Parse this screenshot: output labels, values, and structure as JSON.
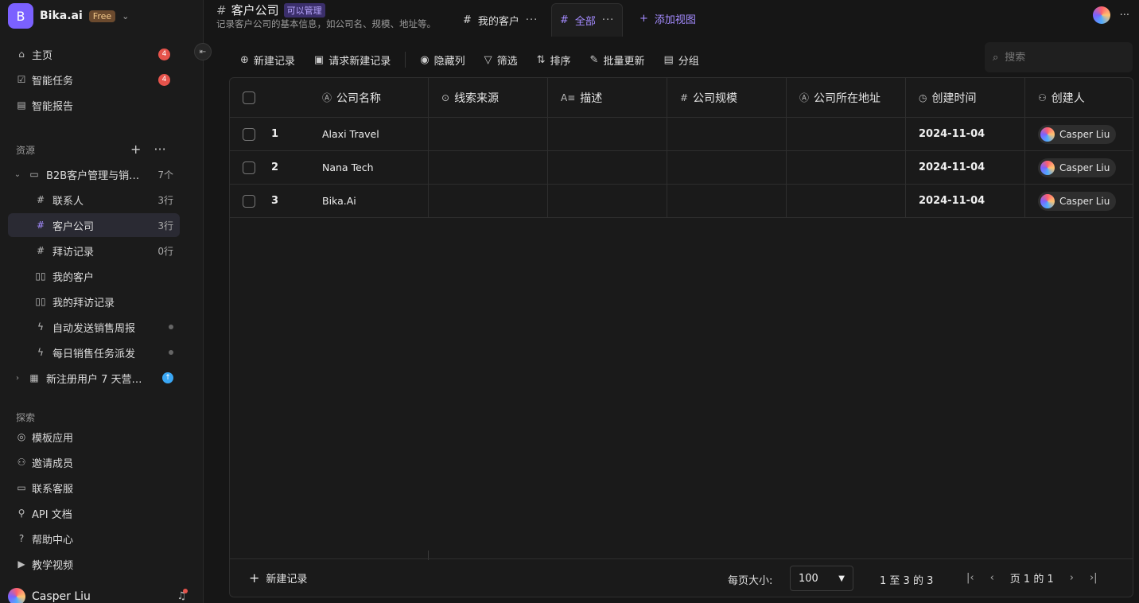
{
  "workspace": {
    "initial": "B",
    "name": "Bika.ai",
    "plan": "Free"
  },
  "nav": [
    {
      "label": "主页",
      "badge": "4"
    },
    {
      "label": "智能任务",
      "badge": "4"
    },
    {
      "label": "智能报告"
    }
  ],
  "resources": {
    "title": "资源",
    "folder": {
      "label": "B2B客户管理与销…",
      "count": "7个"
    },
    "items": [
      {
        "label": "联系人",
        "count": "3行"
      },
      {
        "label": "客户公司",
        "count": "3行"
      },
      {
        "label": "拜访记录",
        "count": "0行"
      },
      {
        "label": "我的客户"
      },
      {
        "label": "我的拜访记录"
      },
      {
        "label": "自动发送销售周报"
      },
      {
        "label": "每日销售任务派发"
      }
    ],
    "second_folder": {
      "label": "新注册用户 7 天营…"
    }
  },
  "explore": {
    "title": "探索",
    "items": [
      {
        "label": "模板应用"
      },
      {
        "label": "邀请成员"
      },
      {
        "label": "联系客服"
      },
      {
        "label": "API 文档"
      },
      {
        "label": "帮助中心"
      },
      {
        "label": "教学视频"
      }
    ]
  },
  "user": {
    "name": "Casper Liu"
  },
  "header": {
    "title": "客户公司",
    "permission": "可以管理",
    "description": "记录客户公司的基本信息，如公司名、规模、地址等。",
    "tabs": [
      {
        "label": "我的客户"
      },
      {
        "label": "全部"
      }
    ],
    "add_view": "添加视图"
  },
  "toolbar": {
    "new_record": "新建记录",
    "request_new_record": "请求新建记录",
    "hide_columns": "隐藏列",
    "filter": "筛选",
    "sort": "排序",
    "bulk_update": "批量更新",
    "group": "分组"
  },
  "search": {
    "placeholder": "搜索"
  },
  "columns": [
    "公司名称",
    "线索来源",
    "描述",
    "公司规模",
    "公司所在地址",
    "创建时间",
    "创建人"
  ],
  "rows": [
    {
      "num": "1",
      "company": "Alaxi Travel",
      "created": "2024-11-04",
      "creator": "Casper Liu"
    },
    {
      "num": "2",
      "company": "Nana Tech",
      "created": "2024-11-04",
      "creator": "Casper Liu"
    },
    {
      "num": "3",
      "company": "Bika.Ai",
      "created": "2024-11-04",
      "creator": "Casper Liu"
    }
  ],
  "footer": {
    "new_record": "新建记录",
    "page_size_label": "每页大小:",
    "page_size": "100",
    "range": "1 至 3 的 3",
    "page": "页 1 的 1"
  }
}
